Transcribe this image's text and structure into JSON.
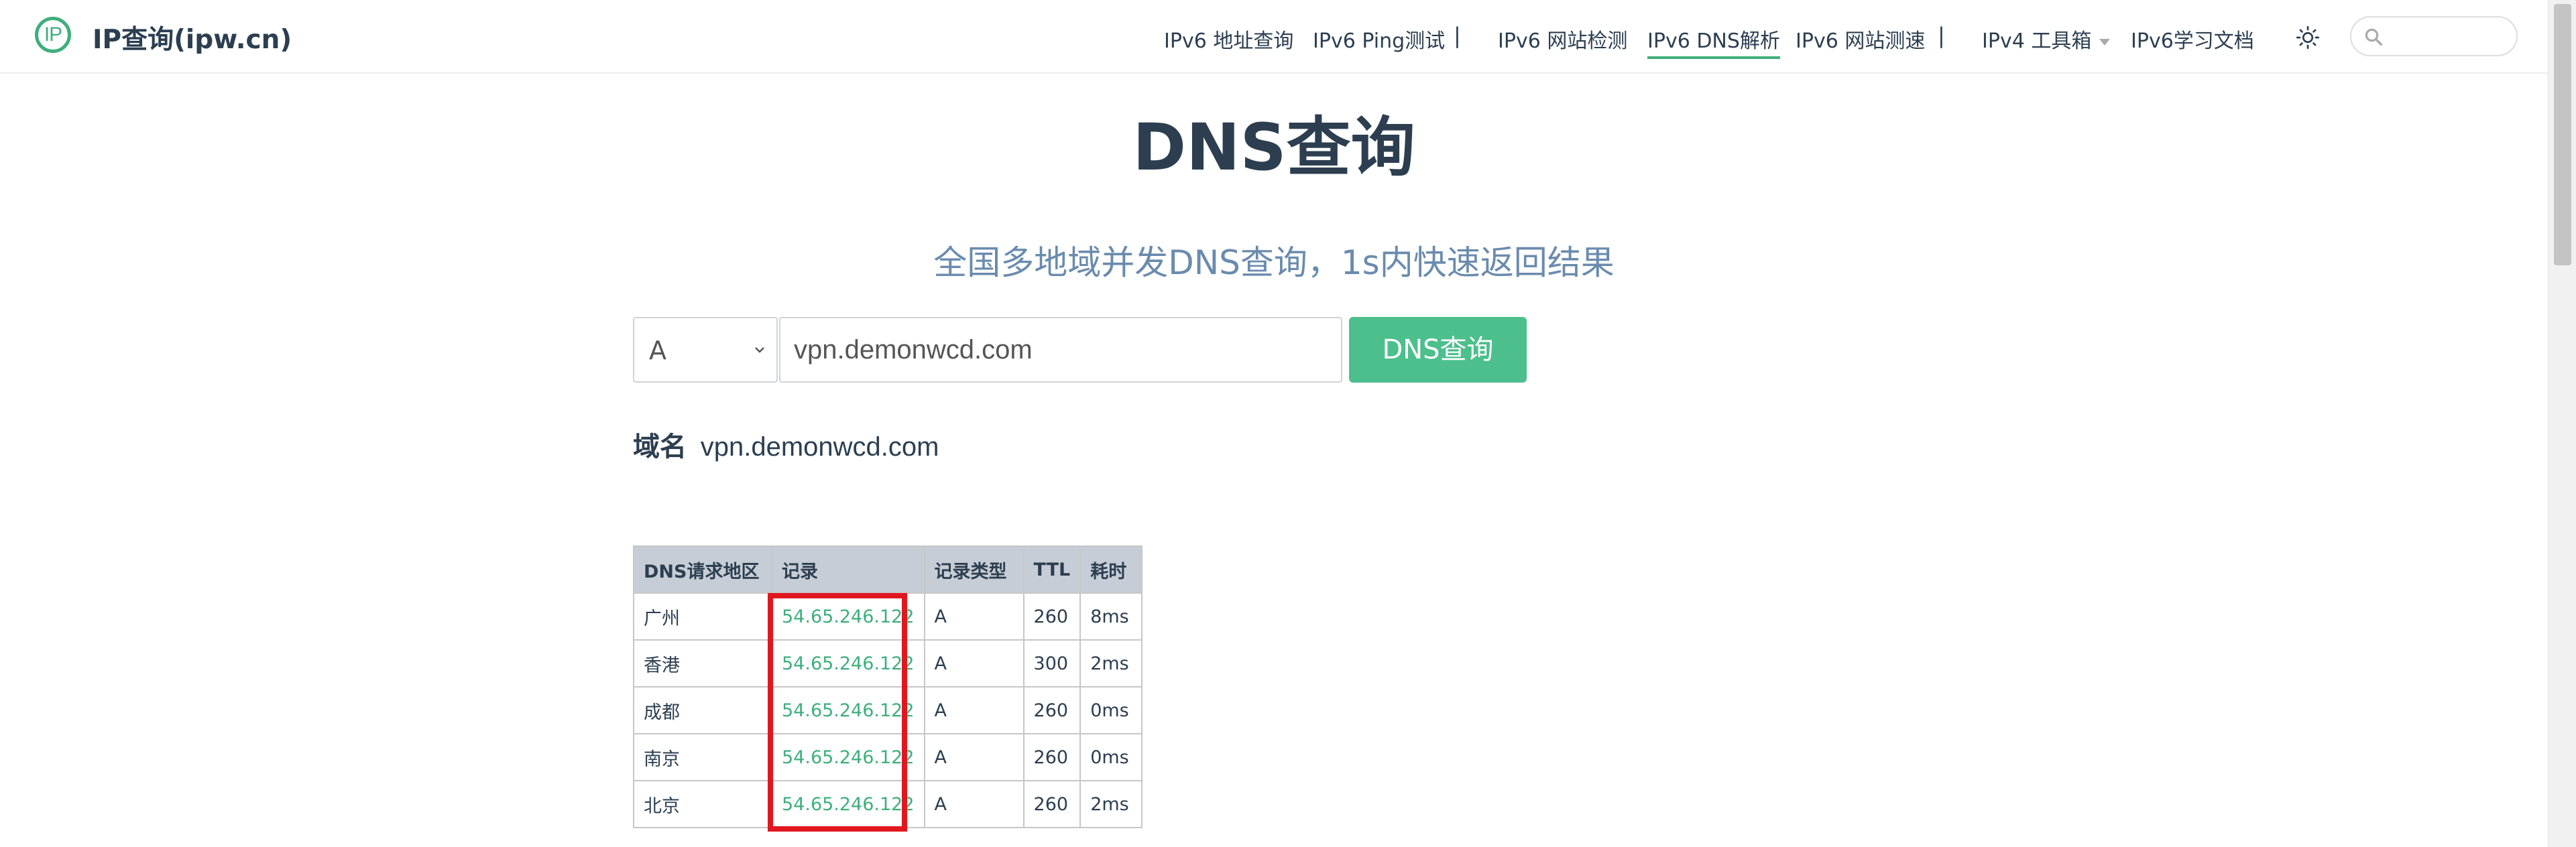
{
  "header": {
    "logo_text": "IP",
    "site_title": "IP查询(ipw.cn)",
    "nav": [
      {
        "label": "IPv6 地址查询"
      },
      {
        "label": "IPv6 Ping测试"
      },
      {
        "label": "IPv6 网站检测"
      },
      {
        "label": "IPv6 DNS解析",
        "active": true
      },
      {
        "label": "IPv6 网站测速"
      },
      {
        "label": "IPv4 工具箱",
        "dropdown": true
      },
      {
        "label": "IPv6学习文档"
      }
    ],
    "separator": "|",
    "theme_icon": "sun-icon",
    "search": {
      "placeholder": "",
      "icon": "search-icon"
    }
  },
  "main": {
    "title": "DNS查询",
    "subtitle": "全国多地域并发DNS查询，1s内快速返回结果",
    "record_type": "A",
    "domain_input_value": "vpn.demonwcd.com",
    "query_button": "DNS查询",
    "domain_label": "域名",
    "domain_value": "vpn.demonwcd.com"
  },
  "table": {
    "headers": [
      "DNS请求地区",
      "记录",
      "记录类型",
      "TTL",
      "耗时"
    ],
    "rows": [
      [
        "广州",
        "54.65.246.122",
        "A",
        "260",
        "8ms"
      ],
      [
        "香港",
        "54.65.246.122",
        "A",
        "300",
        "2ms"
      ],
      [
        "成都",
        "54.65.246.122",
        "A",
        "260",
        "0ms"
      ],
      [
        "南京",
        "54.65.246.122",
        "A",
        "260",
        "0ms"
      ],
      [
        "北京",
        "54.65.246.122",
        "A",
        "260",
        "2ms"
      ]
    ]
  },
  "colors": {
    "accent": "#3eaf7c",
    "button": "#4cbf8c",
    "highlight_box": "#e0171f",
    "subtitle": "#6a8bad",
    "text": "#2c3e50"
  }
}
